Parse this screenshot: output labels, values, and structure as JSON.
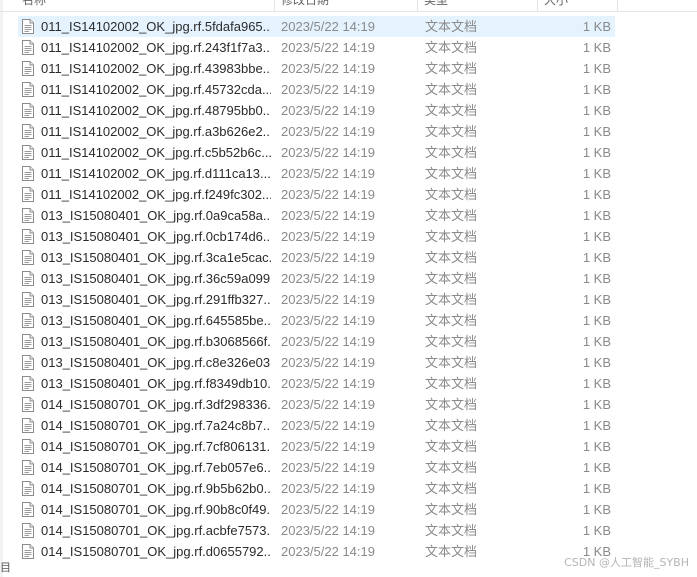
{
  "header": {
    "name_label": "名称",
    "date_label": "修改日期",
    "type_label": "类型",
    "size_label": "大小"
  },
  "files": [
    {
      "name": "011_IS14102002_OK_jpg.rf.5fdafa965...",
      "date": "2023/5/22 14:19",
      "type": "文本文档",
      "size": "1 KB"
    },
    {
      "name": "011_IS14102002_OK_jpg.rf.243f1f7a3...",
      "date": "2023/5/22 14:19",
      "type": "文本文档",
      "size": "1 KB"
    },
    {
      "name": "011_IS14102002_OK_jpg.rf.43983bbe...",
      "date": "2023/5/22 14:19",
      "type": "文本文档",
      "size": "1 KB"
    },
    {
      "name": "011_IS14102002_OK_jpg.rf.45732cda...",
      "date": "2023/5/22 14:19",
      "type": "文本文档",
      "size": "1 KB"
    },
    {
      "name": "011_IS14102002_OK_jpg.rf.48795bb0...",
      "date": "2023/5/22 14:19",
      "type": "文本文档",
      "size": "1 KB"
    },
    {
      "name": "011_IS14102002_OK_jpg.rf.a3b626e2...",
      "date": "2023/5/22 14:19",
      "type": "文本文档",
      "size": "1 KB"
    },
    {
      "name": "011_IS14102002_OK_jpg.rf.c5b52b6c...",
      "date": "2023/5/22 14:19",
      "type": "文本文档",
      "size": "1 KB"
    },
    {
      "name": "011_IS14102002_OK_jpg.rf.d111ca13...",
      "date": "2023/5/22 14:19",
      "type": "文本文档",
      "size": "1 KB"
    },
    {
      "name": "011_IS14102002_OK_jpg.rf.f249fc302...",
      "date": "2023/5/22 14:19",
      "type": "文本文档",
      "size": "1 KB"
    },
    {
      "name": "013_IS15080401_OK_jpg.rf.0a9ca58a...",
      "date": "2023/5/22 14:19",
      "type": "文本文档",
      "size": "1 KB"
    },
    {
      "name": "013_IS15080401_OK_jpg.rf.0cb174d6...",
      "date": "2023/5/22 14:19",
      "type": "文本文档",
      "size": "1 KB"
    },
    {
      "name": "013_IS15080401_OK_jpg.rf.3ca1e5cac...",
      "date": "2023/5/22 14:19",
      "type": "文本文档",
      "size": "1 KB"
    },
    {
      "name": "013_IS15080401_OK_jpg.rf.36c59a099...",
      "date": "2023/5/22 14:19",
      "type": "文本文档",
      "size": "1 KB"
    },
    {
      "name": "013_IS15080401_OK_jpg.rf.291ffb327...",
      "date": "2023/5/22 14:19",
      "type": "文本文档",
      "size": "1 KB"
    },
    {
      "name": "013_IS15080401_OK_jpg.rf.645585be...",
      "date": "2023/5/22 14:19",
      "type": "文本文档",
      "size": "1 KB"
    },
    {
      "name": "013_IS15080401_OK_jpg.rf.b3068566f...",
      "date": "2023/5/22 14:19",
      "type": "文本文档",
      "size": "1 KB"
    },
    {
      "name": "013_IS15080401_OK_jpg.rf.c8e326e03...",
      "date": "2023/5/22 14:19",
      "type": "文本文档",
      "size": "1 KB"
    },
    {
      "name": "013_IS15080401_OK_jpg.rf.f8349db10...",
      "date": "2023/5/22 14:19",
      "type": "文本文档",
      "size": "1 KB"
    },
    {
      "name": "014_IS15080701_OK_jpg.rf.3df298336...",
      "date": "2023/5/22 14:19",
      "type": "文本文档",
      "size": "1 KB"
    },
    {
      "name": "014_IS15080701_OK_jpg.rf.7a24c8b7...",
      "date": "2023/5/22 14:19",
      "type": "文本文档",
      "size": "1 KB"
    },
    {
      "name": "014_IS15080701_OK_jpg.rf.7cf806131...",
      "date": "2023/5/22 14:19",
      "type": "文本文档",
      "size": "1 KB"
    },
    {
      "name": "014_IS15080701_OK_jpg.rf.7eb057e6...",
      "date": "2023/5/22 14:19",
      "type": "文本文档",
      "size": "1 KB"
    },
    {
      "name": "014_IS15080701_OK_jpg.rf.9b5b62b0...",
      "date": "2023/5/22 14:19",
      "type": "文本文档",
      "size": "1 KB"
    },
    {
      "name": "014_IS15080701_OK_jpg.rf.90b8c0f49...",
      "date": "2023/5/22 14:19",
      "type": "文本文档",
      "size": "1 KB"
    },
    {
      "name": "014_IS15080701_OK_jpg.rf.acbfe7573...",
      "date": "2023/5/22 14:19",
      "type": "文本文档",
      "size": "1 KB"
    },
    {
      "name": "014_IS15080701_OK_jpg.rf.d0655792...",
      "date": "2023/5/22 14:19",
      "type": "文本文档",
      "size": "1 KB"
    }
  ],
  "selected_index": 0,
  "colors": {
    "selection": "#e5f3ff",
    "text_primary": "#2b2b2b",
    "text_secondary": "#8a8a8a"
  },
  "status_glyph": "目",
  "watermark": "CSDN @人工智能_SYBH"
}
